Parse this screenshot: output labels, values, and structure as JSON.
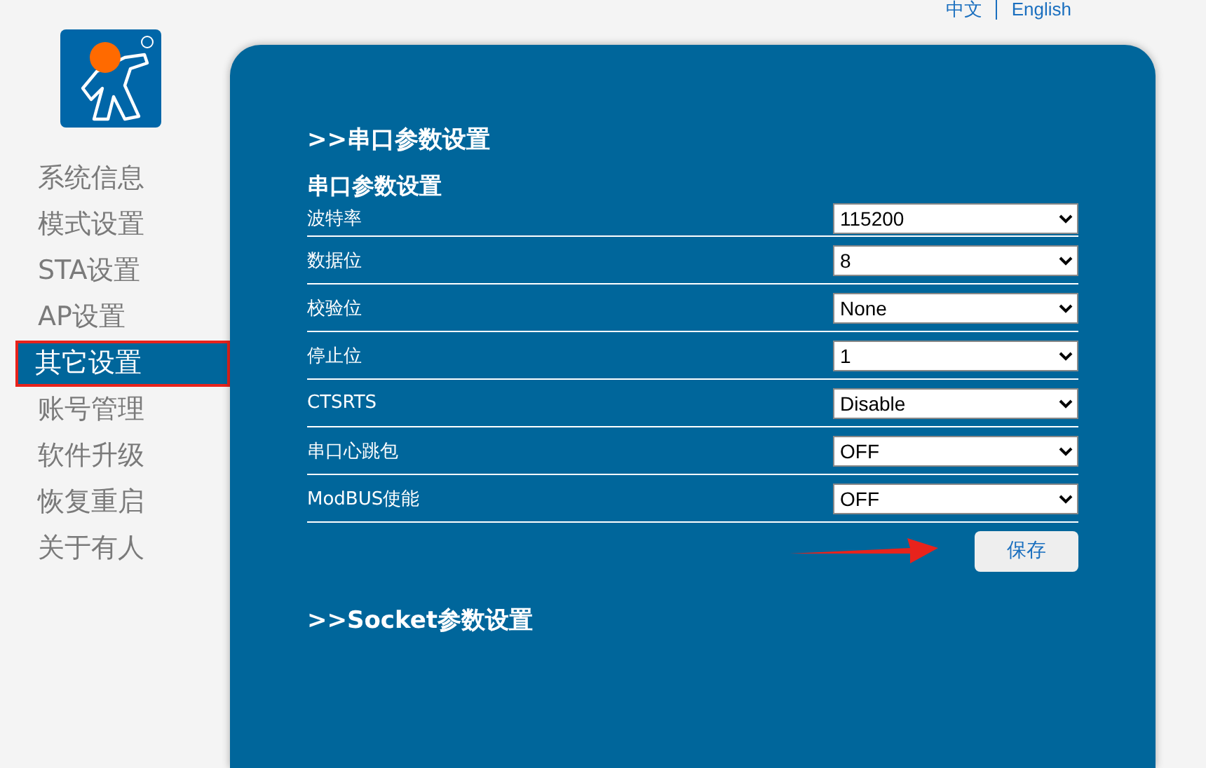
{
  "language_links": [
    {
      "label": "中文"
    },
    {
      "label": "English"
    }
  ],
  "sidebar": {
    "items": [
      {
        "label": "系统信息",
        "selected": false
      },
      {
        "label": "模式设置",
        "selected": false
      },
      {
        "label": "STA设置",
        "selected": false
      },
      {
        "label": "AP设置",
        "selected": false
      },
      {
        "label": "其它设置",
        "selected": true
      },
      {
        "label": "账号管理",
        "selected": false
      },
      {
        "label": "软件升级",
        "selected": false
      },
      {
        "label": "恢复重启",
        "selected": false
      },
      {
        "label": "关于有人",
        "selected": false
      }
    ]
  },
  "panel": {
    "section_title": ">>串口参数设置",
    "group_title": "串口参数设置",
    "fields": [
      {
        "label": "波特率",
        "value": "115200"
      },
      {
        "label": "数据位",
        "value": "8"
      },
      {
        "label": "校验位",
        "value": "None"
      },
      {
        "label": "停止位",
        "value": "1"
      },
      {
        "label": "CTSRTS",
        "value": "Disable"
      },
      {
        "label": "串口心跳包",
        "value": "OFF"
      },
      {
        "label": "ModBUS使能",
        "value": "OFF"
      }
    ],
    "save_button": "保存",
    "next_section_title": ">>Socket参数设置"
  }
}
